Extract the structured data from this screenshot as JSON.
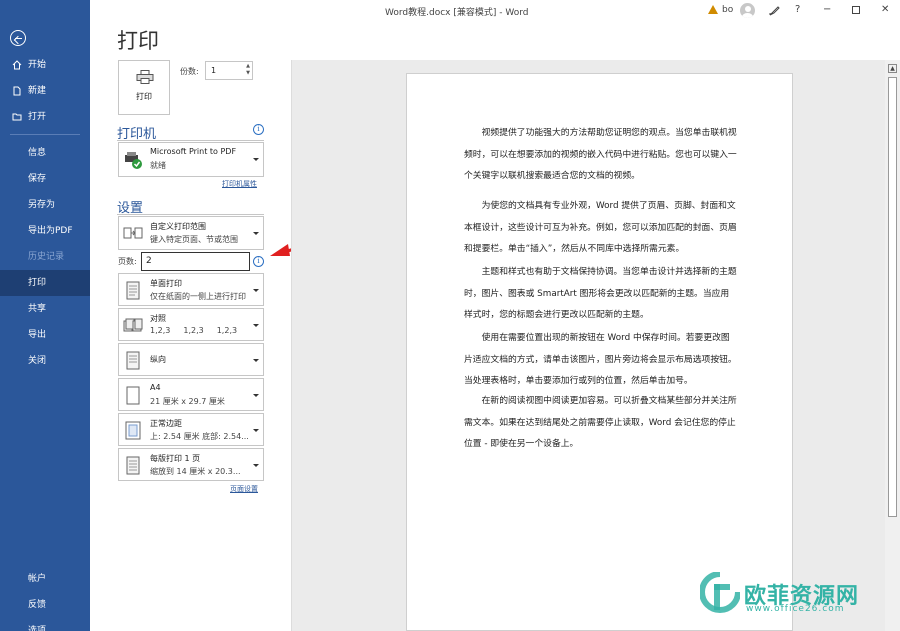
{
  "window": {
    "title": "Word教程.docx [兼容模式] - Word",
    "user": "bo",
    "controls": {
      "help": "?",
      "minimize": "−",
      "close": "✕"
    }
  },
  "nav": {
    "items": [
      {
        "label": "开始"
      },
      {
        "label": "新建"
      },
      {
        "label": "打开"
      },
      {
        "label": "信息"
      },
      {
        "label": "保存"
      },
      {
        "label": "另存为"
      },
      {
        "label": "导出为PDF"
      },
      {
        "label": "历史记录"
      },
      {
        "label": "打印"
      },
      {
        "label": "共享"
      },
      {
        "label": "导出"
      },
      {
        "label": "关闭"
      },
      {
        "label": "帐户"
      },
      {
        "label": "反馈"
      },
      {
        "label": "选项"
      }
    ],
    "active": "打印"
  },
  "print": {
    "page_title": "打印",
    "print_button_label": "打印",
    "copies_label": "份数:",
    "copies_value": "1",
    "printer_section": "打印机",
    "printer_name": "Microsoft Print to PDF",
    "printer_status": "就绪",
    "printer_properties_link": "打印机属性",
    "settings_section": "设置",
    "range": {
      "title": "自定义打印范围",
      "subtitle": "键入特定页面、节或范围"
    },
    "pages_label": "页数:",
    "pages_value": "2",
    "sides": {
      "title": "单面打印",
      "subtitle": "仅在纸面的一侧上进行打印"
    },
    "collate": {
      "title": "对照",
      "sub1": "1,2,3",
      "sub2": "1,2,3",
      "sub3": "1,2,3"
    },
    "orientation": {
      "title": "纵向"
    },
    "paper": {
      "title": "A4",
      "subtitle": "21 厘米 x 29.7 厘米"
    },
    "margins": {
      "title": "正常边距",
      "subtitle": "上: 2.54 厘米 底部: 2.54..."
    },
    "pages_per_sheet": {
      "title": "每版打印 1 页",
      "subtitle": "缩放到 14 厘米 x 20.3..."
    },
    "page_setup_link": "页面设置"
  },
  "document": {
    "paragraphs": [
      "视频提供了功能强大的方法帮助您证明您的观点。当您单击联机视频时，可以在想要添加的视频的嵌入代码中进行粘贴。您也可以键入一个关键字以联机搜索最适合您的文档的视频。",
      "为使您的文档具有专业外观，Word 提供了页眉、页脚、封面和文本框设计，这些设计可互为补充。例如，您可以添加匹配的封面、页眉和提要栏。单击“插入”，然后从不同库中选择所需元素。",
      "主题和样式也有助于文档保持协调。当您单击设计并选择新的主题时，图片、图表或 SmartArt 图形将会更改以匹配新的主题。当应用样式时，您的标题会进行更改以匹配新的主题。",
      "使用在需要位置出现的新按钮在 Word 中保存时间。若要更改图片适应文档的方式，请单击该图片，图片旁边将会显示布局选项按钮。当处理表格时，单击要添加行或列的位置，然后单击加号。",
      "在新的阅读视图中阅读更加容易。可以折叠文档某些部分并关注所需文本。如果在达到结尾处之前需要停止读取，Word 会记住您的停止位置 - 即使在另一个设备上。"
    ]
  },
  "watermark": {
    "text": "欧菲资源网",
    "url": "www.office26.com"
  },
  "colors": {
    "nav_bg": "#2b579a",
    "nav_active": "#1e3f73",
    "accent": "#2b579a",
    "arrow": "#e02020",
    "watermark": "#34b3a6"
  }
}
